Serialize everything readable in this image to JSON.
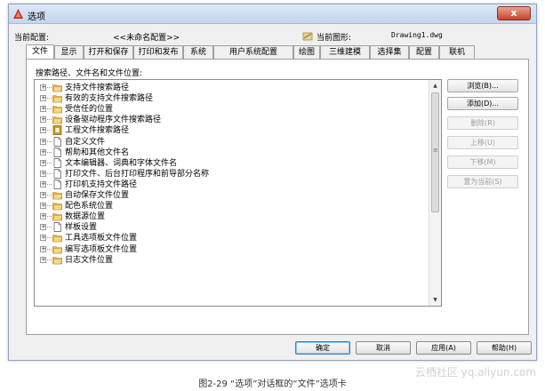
{
  "window": {
    "title": "选项",
    "close_label": "x"
  },
  "profile": {
    "current_profile_label": "当前配置:",
    "current_profile_value": "<<未命名配置>>",
    "current_drawing_label": "当前图形:",
    "current_drawing_value": "Drawing1.dwg"
  },
  "tabs": [
    {
      "label": "文件",
      "active": true
    },
    {
      "label": "显示"
    },
    {
      "label": "打开和保存"
    },
    {
      "label": "打印和发布"
    },
    {
      "label": "系统"
    },
    {
      "label": "用户系统配置"
    },
    {
      "label": "绘图"
    },
    {
      "label": "三维建模"
    },
    {
      "label": "选择集"
    },
    {
      "label": "配置"
    },
    {
      "label": "联机"
    }
  ],
  "panel": {
    "label": "搜索路径、文件名和文件位置:"
  },
  "tree": {
    "items": [
      {
        "label": "支持文件搜索路径",
        "icon": "folder-icon"
      },
      {
        "label": "有效的支持文件搜索路径",
        "icon": "folder-icon"
      },
      {
        "label": "受信任的位置",
        "icon": "folder-icon"
      },
      {
        "label": "设备驱动程序文件搜索路径",
        "icon": "folder-icon"
      },
      {
        "label": "工程文件搜索路径",
        "icon": "project-icon"
      },
      {
        "label": "自定义文件",
        "icon": "document-icon"
      },
      {
        "label": "帮助和其他文件名",
        "icon": "document-icon"
      },
      {
        "label": "文本编辑器、词典和字体文件名",
        "icon": "document-icon"
      },
      {
        "label": "打印文件、后台打印程序和前导部分名称",
        "icon": "document-icon"
      },
      {
        "label": "打印机支持文件路径",
        "icon": "document-icon"
      },
      {
        "label": "自动保存文件位置",
        "icon": "folder-icon"
      },
      {
        "label": "配色系统位置",
        "icon": "folder-icon"
      },
      {
        "label": "数据源位置",
        "icon": "folder-icon"
      },
      {
        "label": "样板设置",
        "icon": "document-icon"
      },
      {
        "label": "工具选项板文件位置",
        "icon": "folder-icon"
      },
      {
        "label": "编写选项板文件位置",
        "icon": "folder-icon"
      },
      {
        "label": "日志文件位置",
        "icon": "folder-icon"
      }
    ]
  },
  "side_buttons": [
    {
      "label": "浏览(B)...",
      "enabled": true
    },
    {
      "label": "添加(D)...",
      "enabled": true
    },
    {
      "label": "删除(R)",
      "enabled": false
    },
    {
      "label": "上移(U)",
      "enabled": false
    },
    {
      "label": "下移(M)",
      "enabled": false
    },
    {
      "label": "置为当前(S)",
      "enabled": false
    }
  ],
  "buttons": {
    "ok": "确定",
    "cancel": "取消",
    "apply": "应用(A)",
    "help": "帮助(H)"
  },
  "caption": "图2-29  “选项”对话框的“文件”选项卡",
  "watermark": "云栖社区 yq.aliyun.com",
  "colors": {
    "folder": "#e8b84a",
    "folder_dark": "#b8862a",
    "project": "#c8a030",
    "accent_blue": "#3c7fb1"
  }
}
